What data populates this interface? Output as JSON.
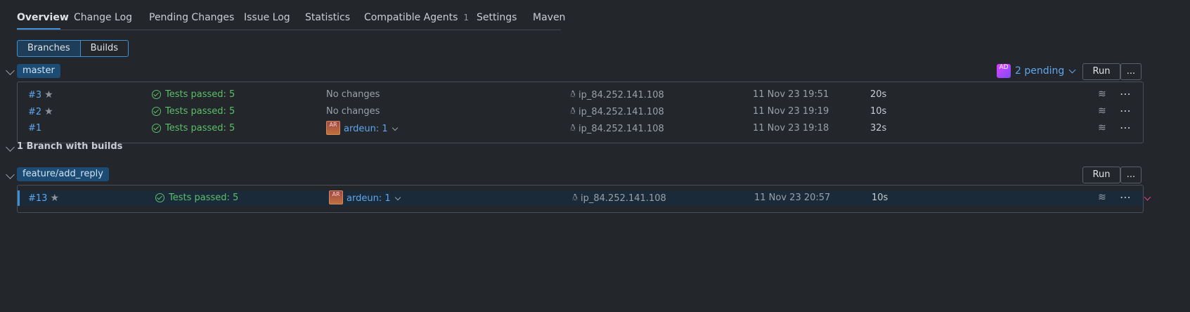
{
  "tabs": [
    {
      "label": "Overview"
    },
    {
      "label": "Change Log"
    },
    {
      "label": "Pending Changes"
    },
    {
      "label": "Issue Log"
    },
    {
      "label": "Statistics"
    },
    {
      "label": "Compatible Agents",
      "count": "1"
    },
    {
      "label": "Settings"
    },
    {
      "label": "Maven"
    }
  ],
  "view_toggle": {
    "branches": "Branches",
    "builds": "Builds"
  },
  "master": {
    "branch": "master",
    "pending_avatar": "AD",
    "pending": "2 pending",
    "run": "Run",
    "more": "...",
    "builds": [
      {
        "number": "#3",
        "starred": true,
        "status": "Tests passed: 5",
        "changes": "No changes",
        "agent": "ip_84.252.141.108",
        "date": "11 Nov 23 19:51",
        "duration": "20s"
      },
      {
        "number": "#2",
        "starred": true,
        "status": "Tests passed: 5",
        "changes": "No changes",
        "agent": "ip_84.252.141.108",
        "date": "11 Nov 23 19:19",
        "duration": "10s"
      },
      {
        "number": "#1",
        "starred": false,
        "status": "Tests passed: 5",
        "changes": "ardeun: 1",
        "changes_avatar": "AR",
        "agent": "ip_84.252.141.108",
        "date": "11 Nov 23 19:18",
        "duration": "32s"
      }
    ]
  },
  "section_title": "1 Branch with builds",
  "feature": {
    "branch": "feature/add_reply",
    "run": "Run",
    "more": "...",
    "builds": [
      {
        "number": "#13",
        "starred": true,
        "status": "Tests passed: 5",
        "changes": "ardeun: 1",
        "changes_avatar": "AR",
        "agent": "ip_84.252.141.108",
        "date": "11 Nov 23 20:57",
        "duration": "10s"
      }
    ]
  },
  "colors": {
    "accent": "#3f8fd6",
    "link": "#5ea7ef",
    "success": "#5cbf6a",
    "background": "#23262b"
  },
  "icons": [
    "check-circle-icon",
    "star-icon",
    "linux-icon",
    "layers-icon",
    "more-icon",
    "chevron-down-icon"
  ]
}
